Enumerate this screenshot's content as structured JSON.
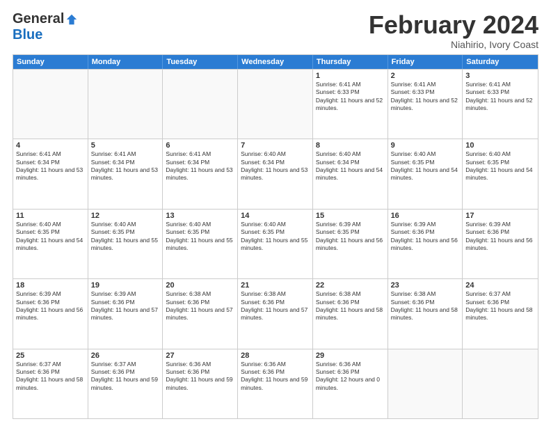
{
  "logo": {
    "general": "General",
    "blue": "Blue"
  },
  "title": "February 2024",
  "location": "Niahirio, Ivory Coast",
  "weekdays": [
    "Sunday",
    "Monday",
    "Tuesday",
    "Wednesday",
    "Thursday",
    "Friday",
    "Saturday"
  ],
  "weeks": [
    [
      {
        "day": "",
        "empty": true
      },
      {
        "day": "",
        "empty": true
      },
      {
        "day": "",
        "empty": true
      },
      {
        "day": "",
        "empty": true
      },
      {
        "day": "1",
        "sunrise": "6:41 AM",
        "sunset": "6:33 PM",
        "daylight": "11 hours and 52 minutes."
      },
      {
        "day": "2",
        "sunrise": "6:41 AM",
        "sunset": "6:33 PM",
        "daylight": "11 hours and 52 minutes."
      },
      {
        "day": "3",
        "sunrise": "6:41 AM",
        "sunset": "6:33 PM",
        "daylight": "11 hours and 52 minutes."
      }
    ],
    [
      {
        "day": "4",
        "sunrise": "6:41 AM",
        "sunset": "6:34 PM",
        "daylight": "11 hours and 53 minutes."
      },
      {
        "day": "5",
        "sunrise": "6:41 AM",
        "sunset": "6:34 PM",
        "daylight": "11 hours and 53 minutes."
      },
      {
        "day": "6",
        "sunrise": "6:41 AM",
        "sunset": "6:34 PM",
        "daylight": "11 hours and 53 minutes."
      },
      {
        "day": "7",
        "sunrise": "6:40 AM",
        "sunset": "6:34 PM",
        "daylight": "11 hours and 53 minutes."
      },
      {
        "day": "8",
        "sunrise": "6:40 AM",
        "sunset": "6:34 PM",
        "daylight": "11 hours and 54 minutes."
      },
      {
        "day": "9",
        "sunrise": "6:40 AM",
        "sunset": "6:35 PM",
        "daylight": "11 hours and 54 minutes."
      },
      {
        "day": "10",
        "sunrise": "6:40 AM",
        "sunset": "6:35 PM",
        "daylight": "11 hours and 54 minutes."
      }
    ],
    [
      {
        "day": "11",
        "sunrise": "6:40 AM",
        "sunset": "6:35 PM",
        "daylight": "11 hours and 54 minutes."
      },
      {
        "day": "12",
        "sunrise": "6:40 AM",
        "sunset": "6:35 PM",
        "daylight": "11 hours and 55 minutes."
      },
      {
        "day": "13",
        "sunrise": "6:40 AM",
        "sunset": "6:35 PM",
        "daylight": "11 hours and 55 minutes."
      },
      {
        "day": "14",
        "sunrise": "6:40 AM",
        "sunset": "6:35 PM",
        "daylight": "11 hours and 55 minutes."
      },
      {
        "day": "15",
        "sunrise": "6:39 AM",
        "sunset": "6:35 PM",
        "daylight": "11 hours and 56 minutes."
      },
      {
        "day": "16",
        "sunrise": "6:39 AM",
        "sunset": "6:36 PM",
        "daylight": "11 hours and 56 minutes."
      },
      {
        "day": "17",
        "sunrise": "6:39 AM",
        "sunset": "6:36 PM",
        "daylight": "11 hours and 56 minutes."
      }
    ],
    [
      {
        "day": "18",
        "sunrise": "6:39 AM",
        "sunset": "6:36 PM",
        "daylight": "11 hours and 56 minutes."
      },
      {
        "day": "19",
        "sunrise": "6:39 AM",
        "sunset": "6:36 PM",
        "daylight": "11 hours and 57 minutes."
      },
      {
        "day": "20",
        "sunrise": "6:38 AM",
        "sunset": "6:36 PM",
        "daylight": "11 hours and 57 minutes."
      },
      {
        "day": "21",
        "sunrise": "6:38 AM",
        "sunset": "6:36 PM",
        "daylight": "11 hours and 57 minutes."
      },
      {
        "day": "22",
        "sunrise": "6:38 AM",
        "sunset": "6:36 PM",
        "daylight": "11 hours and 58 minutes."
      },
      {
        "day": "23",
        "sunrise": "6:38 AM",
        "sunset": "6:36 PM",
        "daylight": "11 hours and 58 minutes."
      },
      {
        "day": "24",
        "sunrise": "6:37 AM",
        "sunset": "6:36 PM",
        "daylight": "11 hours and 58 minutes."
      }
    ],
    [
      {
        "day": "25",
        "sunrise": "6:37 AM",
        "sunset": "6:36 PM",
        "daylight": "11 hours and 58 minutes."
      },
      {
        "day": "26",
        "sunrise": "6:37 AM",
        "sunset": "6:36 PM",
        "daylight": "11 hours and 59 minutes."
      },
      {
        "day": "27",
        "sunrise": "6:36 AM",
        "sunset": "6:36 PM",
        "daylight": "11 hours and 59 minutes."
      },
      {
        "day": "28",
        "sunrise": "6:36 AM",
        "sunset": "6:36 PM",
        "daylight": "11 hours and 59 minutes."
      },
      {
        "day": "29",
        "sunrise": "6:36 AM",
        "sunset": "6:36 PM",
        "daylight": "12 hours and 0 minutes."
      },
      {
        "day": "",
        "empty": true
      },
      {
        "day": "",
        "empty": true
      }
    ]
  ]
}
